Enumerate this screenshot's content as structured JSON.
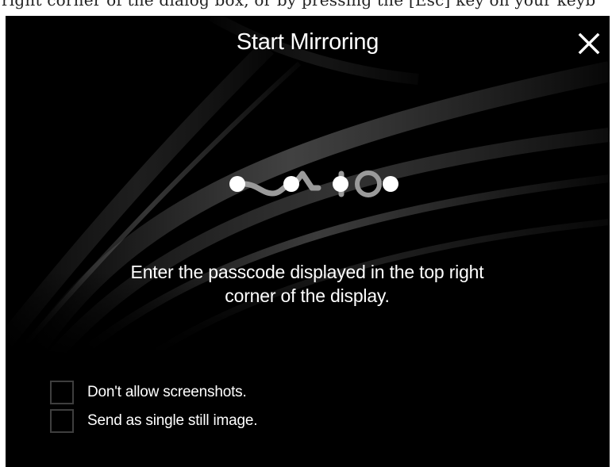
{
  "background_text": "right corner of the dialog box, or by pressing the [Esc] key on your keyb",
  "dialog": {
    "title": "Start Mirroring",
    "close_icon": "close-icon",
    "logo": "vaio-logo",
    "message_line1": "Enter the passcode displayed in the top right",
    "message_line2": "corner of the display.",
    "options": [
      {
        "label": "Don't allow screenshots.",
        "checked": false
      },
      {
        "label": "Send as single still image.",
        "checked": false
      }
    ]
  },
  "colors": {
    "dialog_bg": "#000000",
    "text": "#ffffff",
    "checkbox_border": "#3e3e3e"
  }
}
